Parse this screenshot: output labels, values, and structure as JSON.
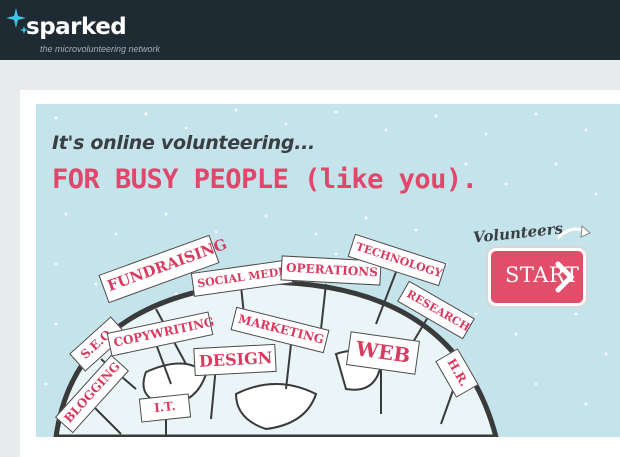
{
  "brand": {
    "name": "sparked",
    "tagline": "the microvolunteering network"
  },
  "hero": {
    "subline": "It's online volunteering...",
    "headline": "FOR BUSY PEOPLE (like you).",
    "cta_caption": "Volunteers",
    "cta_label": "START"
  },
  "signs": [
    "FUNDRAISING",
    "SOCIAL MEDIA",
    "OPERATIONS",
    "TECHNOLOGY",
    "RESEARCH",
    "S.E.O.",
    "COPYWRITING",
    "MARKETING",
    "DESIGN",
    "WEB",
    "H.R.",
    "BLOGGING",
    "I.T."
  ],
  "colors": {
    "topbar": "#1f2b33",
    "accent": "#e0476a",
    "sky": "#c5e3ea"
  }
}
